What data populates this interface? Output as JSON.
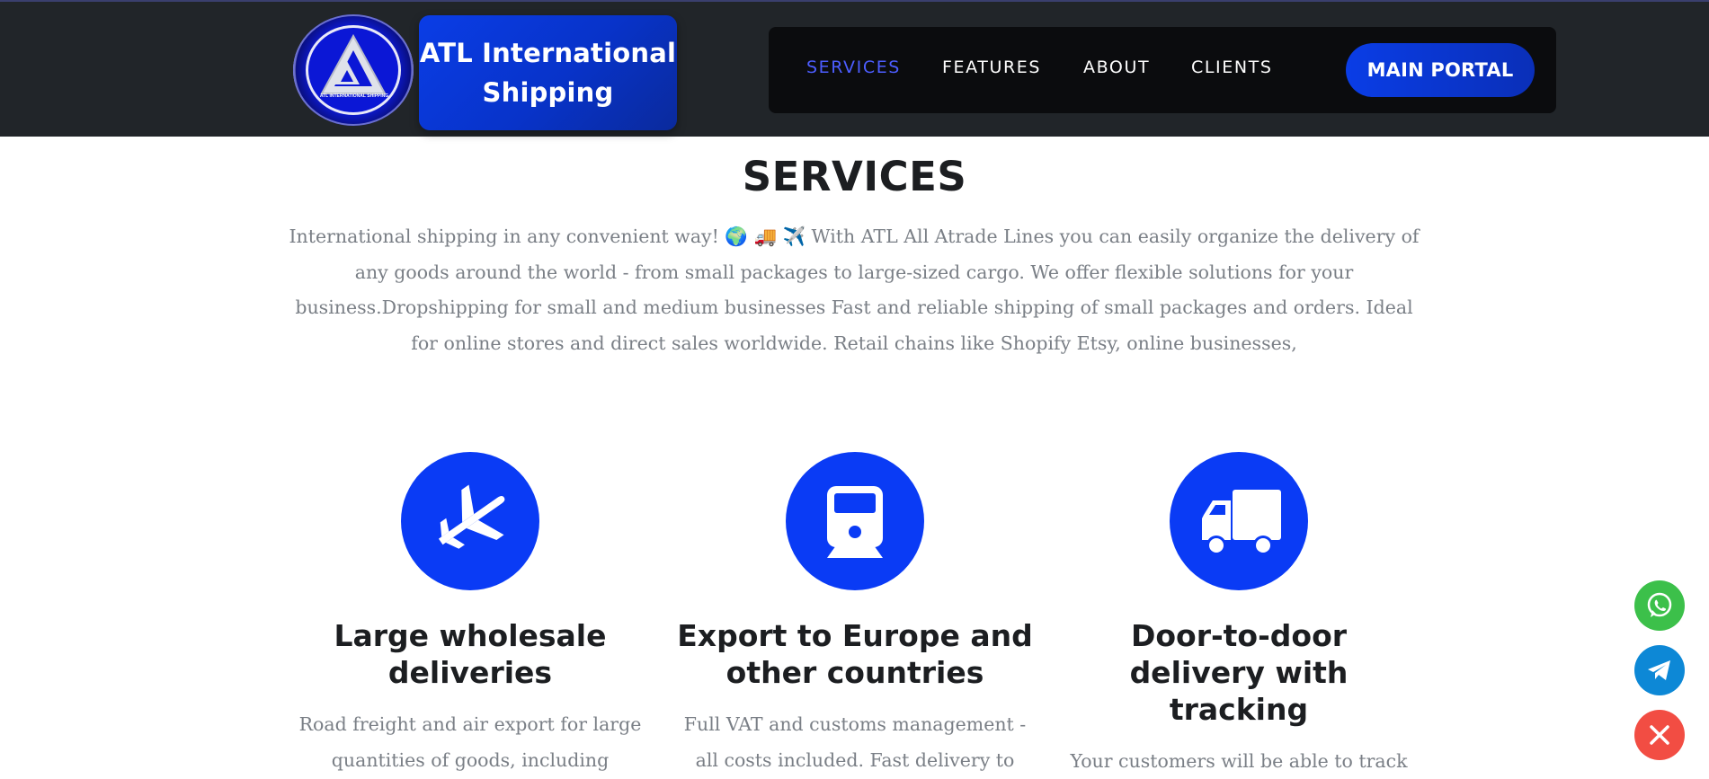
{
  "brand": {
    "name": "ATL International Shipping",
    "name_line1": "ATL International",
    "name_line2": "Shipping",
    "logo_small_text": "ATL INTERNATIONAL SHIPPING",
    "logo_icon": "atl-triangle-logo"
  },
  "nav": {
    "items": [
      {
        "label": "SERVICES",
        "active": true
      },
      {
        "label": "FEATURES",
        "active": false
      },
      {
        "label": "ABOUT",
        "active": false
      },
      {
        "label": "CLIENTS",
        "active": false
      }
    ],
    "portal_button": "MAIN PORTAL"
  },
  "services": {
    "title": "SERVICES",
    "intro": "International shipping in any convenient way! 🌍 🚚 ✈️ With ATL All Atrade Lines you can easily organize the delivery of any goods around the world - from small packages to large-sized cargo. We offer flexible solutions for your business.Dropshipping for small and medium businesses Fast and reliable shipping of small packages and orders. Ideal for online stores and direct sales worldwide. Retail chains like Shopify Etsy, online businesses,",
    "cards": [
      {
        "icon": "plane-icon",
        "title": "Large wholesale deliveries",
        "text": "Road freight and air export for large quantities of goods, including"
      },
      {
        "icon": "train-icon",
        "title": "Export to Europe and other countries",
        "text": "Full VAT and customs management - all costs included. Fast delivery to"
      },
      {
        "icon": "truck-icon",
        "title": "Door-to-door delivery with tracking",
        "text": "Your customers will be able to track orders at every stage of the journey,"
      }
    ]
  },
  "floating": {
    "buttons": [
      "whatsapp-icon",
      "telegram-icon",
      "close-icon"
    ]
  },
  "colors": {
    "header_bg": "#212529",
    "nav_bg": "#0b0c0e",
    "accent": "#0a3bf5",
    "active_nav": "#4c5dff",
    "whatsapp": "#3cc04a",
    "telegram": "#0d88d6",
    "close": "#f24d43"
  }
}
